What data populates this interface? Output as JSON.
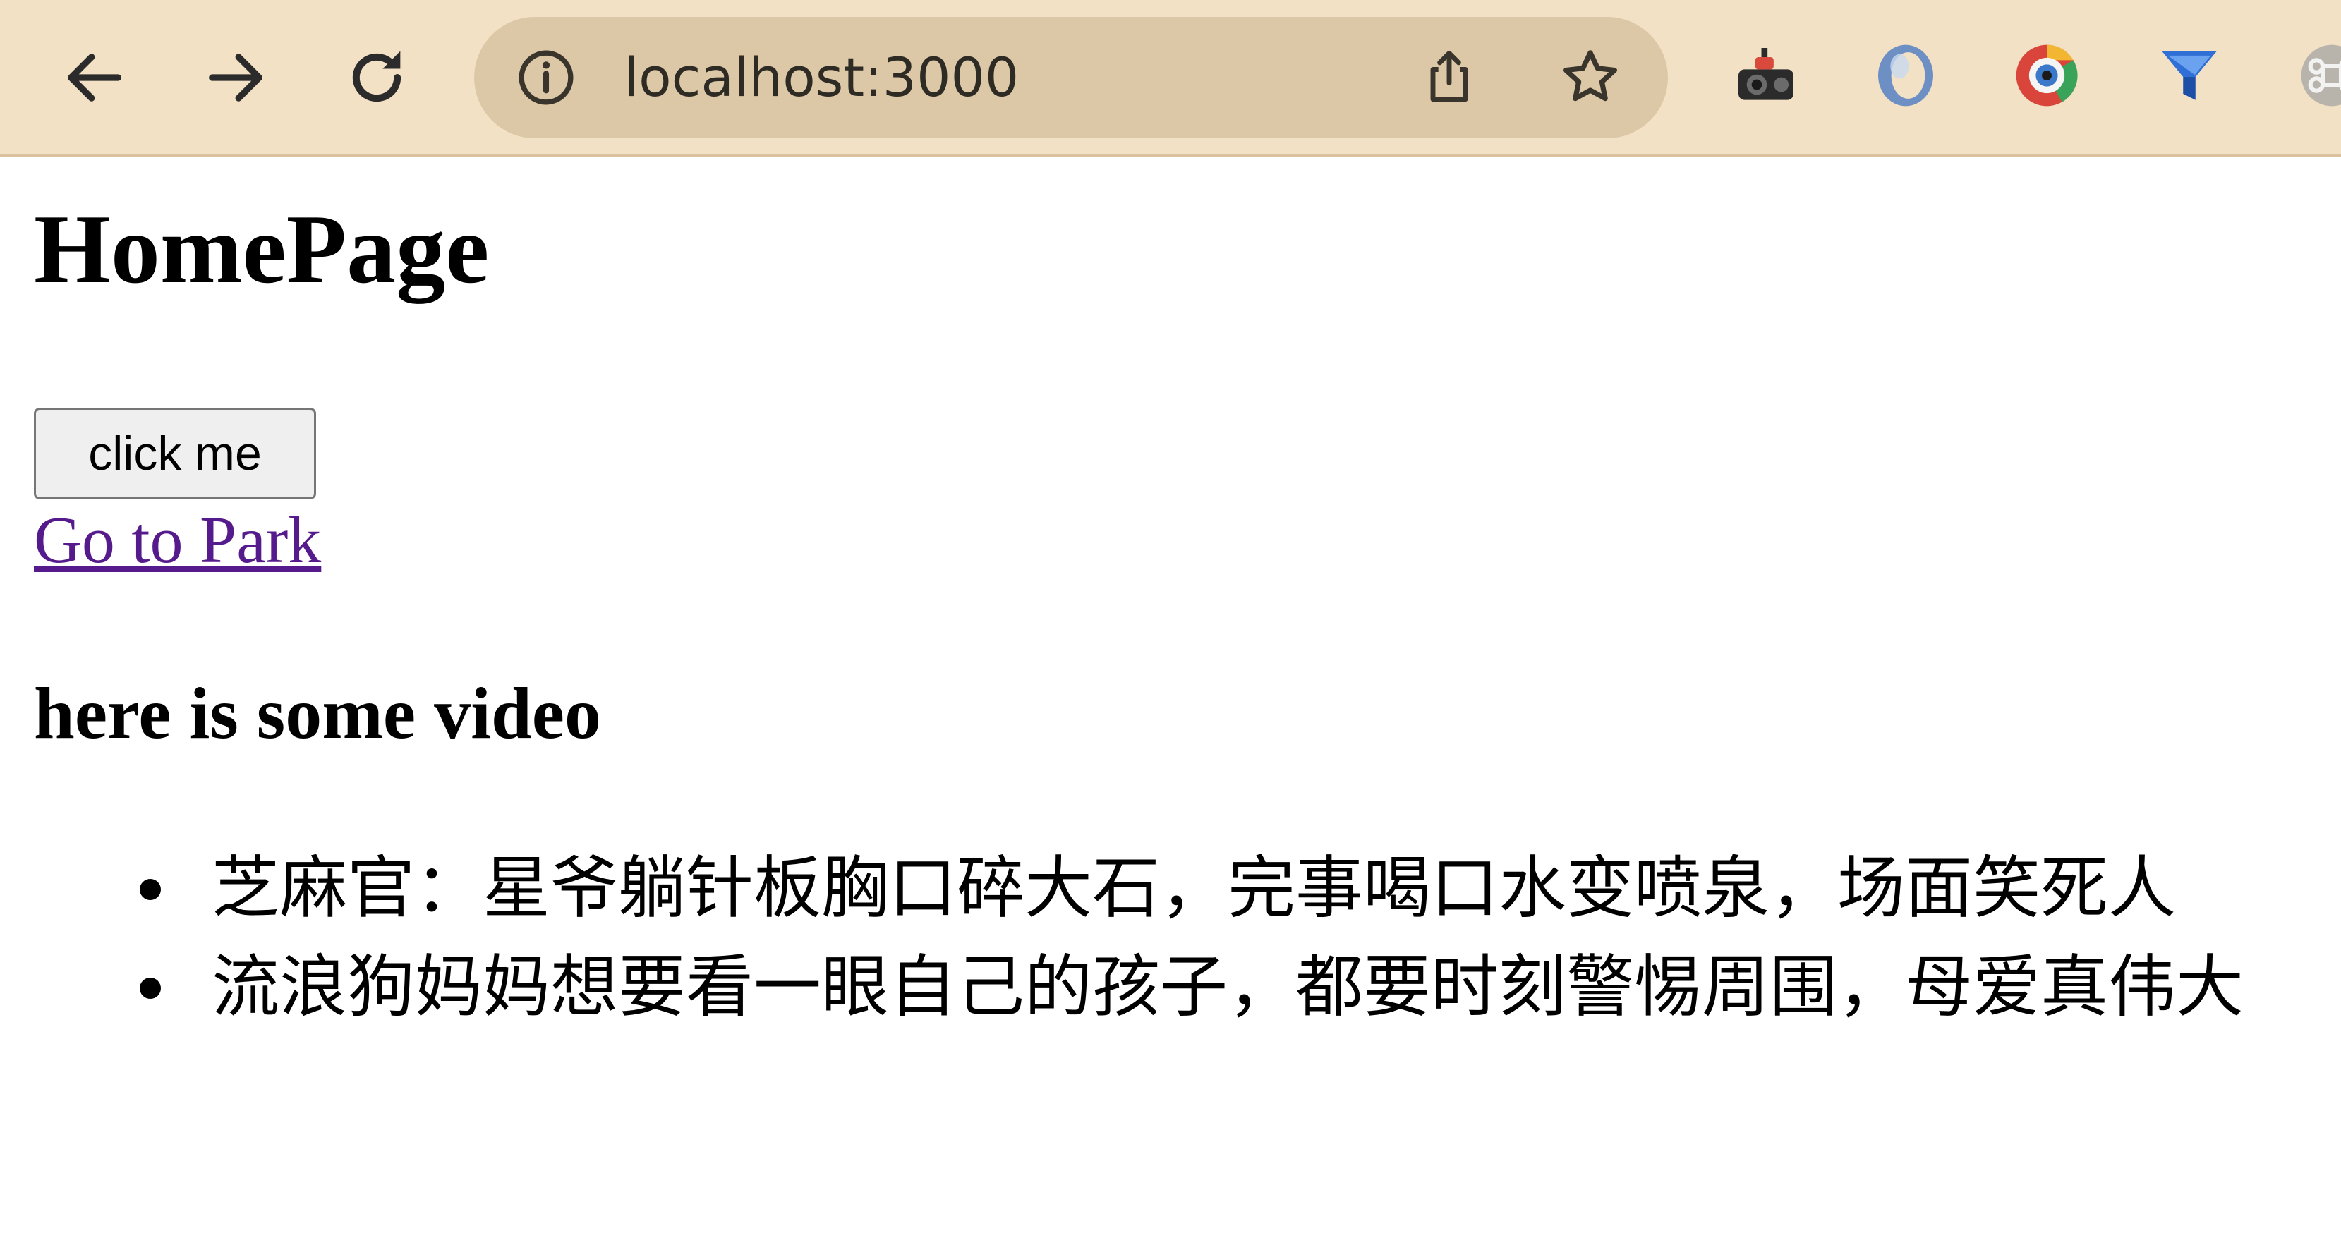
{
  "browser": {
    "url": "localhost:3000",
    "colors": {
      "toolbar_bg": "#f2e1c4",
      "omnibox_bg": "#dcc8a6",
      "visited_link": "#551a8b"
    },
    "icons": [
      "back-arrow-icon",
      "forward-arrow-icon",
      "reload-icon",
      "info-icon",
      "share-icon",
      "bookmark-star-icon"
    ],
    "extensions": [
      "camera-extension-icon",
      "ring-extension-icon",
      "color-picker-extension-icon",
      "funnel-extension-icon",
      "command-extension-icon"
    ]
  },
  "page": {
    "title": "HomePage",
    "button_label": "click me",
    "link_text": "Go to Park",
    "section_title": "here is some video",
    "videos": [
      "芝麻官：星爷躺针板胸口碎大石，完事喝口水变喷泉，场面笑死人",
      "流浪狗妈妈想要看一眼自己的孩子，都要时刻警惕周围，母爱真伟大"
    ]
  }
}
